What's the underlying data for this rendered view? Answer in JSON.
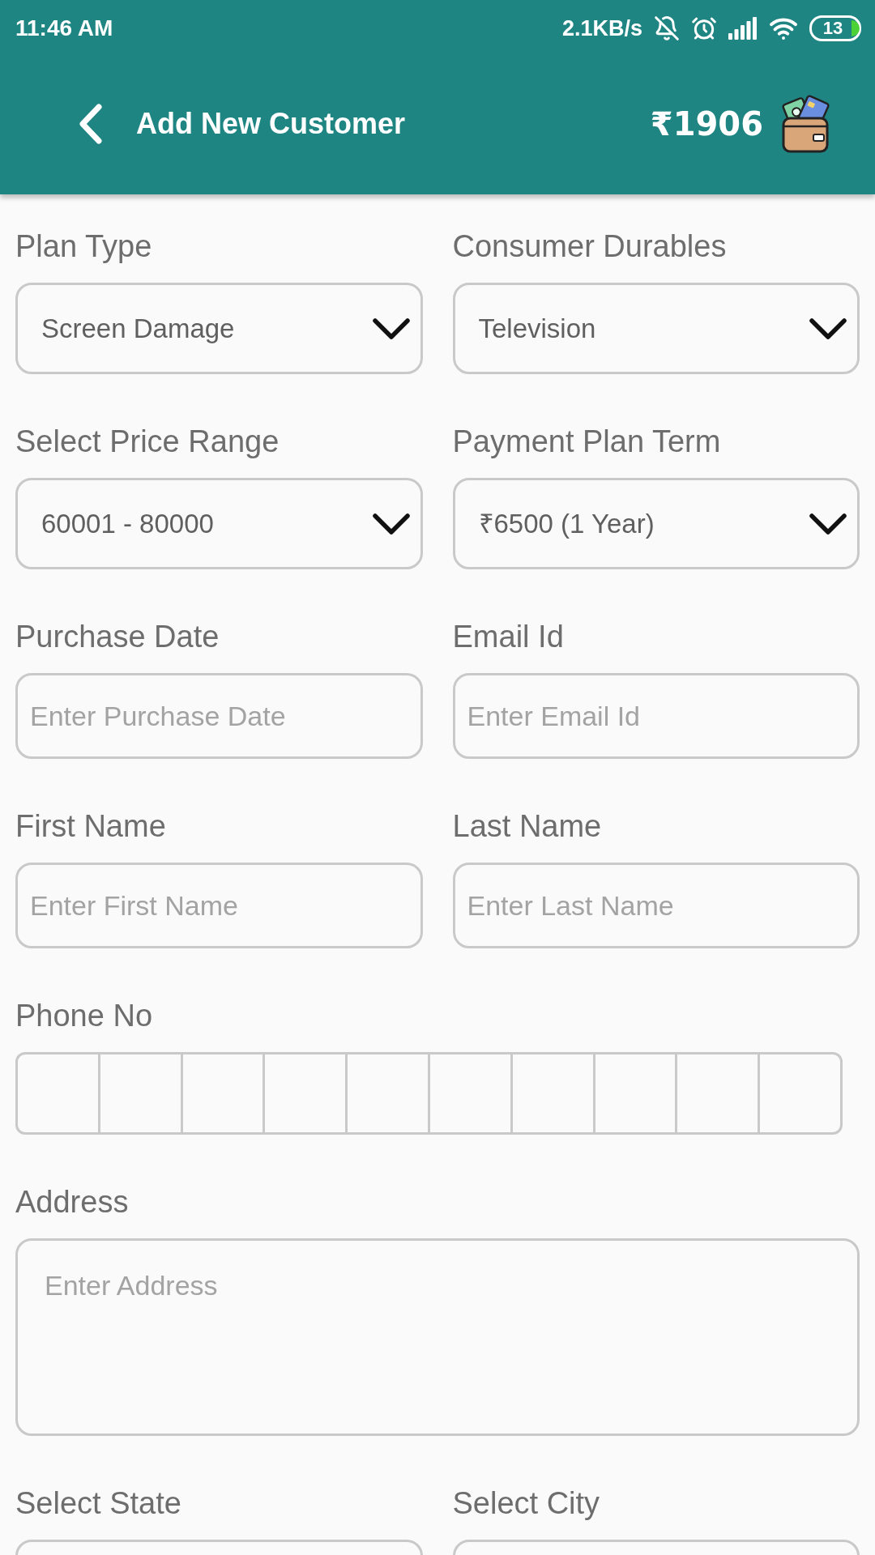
{
  "status_bar": {
    "time": "11:46 AM",
    "network_speed": "2.1KB/s",
    "battery": "13"
  },
  "app_bar": {
    "title": "Add New Customer",
    "balance": "₹1906"
  },
  "form": {
    "fields": [
      {
        "kind": "dropdown",
        "label": "Plan Type",
        "value": "Screen Damage"
      },
      {
        "kind": "dropdown",
        "label": "Consumer Durables",
        "value": "Television"
      },
      {
        "kind": "dropdown",
        "label": "Select Price Range",
        "value": "60001 - 80000"
      },
      {
        "kind": "dropdown",
        "label": "Payment Plan Term",
        "value": "₹6500 (1 Year)"
      },
      {
        "kind": "text",
        "label": "Purchase Date",
        "placeholder": "Enter Purchase Date"
      },
      {
        "kind": "text",
        "label": "Email Id",
        "placeholder": "Enter Email Id"
      },
      {
        "kind": "text",
        "label": "First Name",
        "placeholder": "Enter First Name"
      },
      {
        "kind": "text",
        "label": "Last Name",
        "placeholder": "Enter Last Name"
      },
      {
        "kind": "digits",
        "label": "Phone No"
      },
      {
        "kind": "textarea",
        "label": "Address",
        "placeholder": "Enter Address"
      },
      {
        "kind": "dropdown",
        "label": "Select State"
      },
      {
        "kind": "dropdown",
        "label": "Select City"
      }
    ]
  }
}
